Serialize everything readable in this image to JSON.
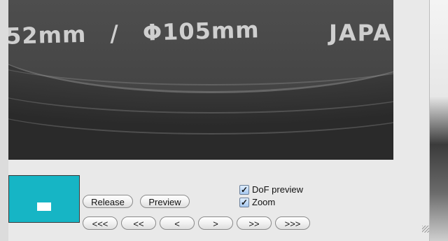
{
  "preview": {
    "lens_text_left": "52mm",
    "lens_text_slash": "/",
    "lens_text_filter": "Φ105mm",
    "lens_text_brand": "JAPA"
  },
  "buttons": {
    "release": "Release",
    "preview": "Preview",
    "nav_far_back": "<<<",
    "nav_back": "<<",
    "nav_step_back": "<",
    "nav_step_forward": ">",
    "nav_forward": ">>",
    "nav_far_forward": ">>>"
  },
  "options": {
    "dof_preview": {
      "label": "DoF preview",
      "checked": true
    },
    "zoom": {
      "label": "Zoom",
      "checked": true
    }
  },
  "colors": {
    "thumbnail_background": "#16b5c5",
    "thumbnail_marker": "#ffffff"
  },
  "icons": {
    "checkmark": "check-icon",
    "resize": "resize-grip-icon"
  }
}
